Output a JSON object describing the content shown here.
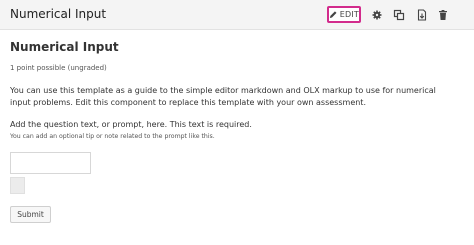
{
  "header": {
    "title": "Numerical Input",
    "edit_label": "EDIT",
    "accent_color": "#d22b8c",
    "icons": [
      "pencil-icon",
      "gear-icon",
      "duplicate-icon",
      "move-icon",
      "trash-icon"
    ]
  },
  "problem": {
    "title": "Numerical Input",
    "points": "1 point possible (ungraded)",
    "description": "You can use this template as a guide to the simple editor markdown and OLX markup to use for numerical input problems. Edit this component to replace this template with your own assessment.",
    "question": "Add the question text, or prompt, here. This text is required.",
    "hint": "You can add an optional tip or note related to the prompt like this.",
    "answer_value": "",
    "submit_label": "Submit"
  }
}
